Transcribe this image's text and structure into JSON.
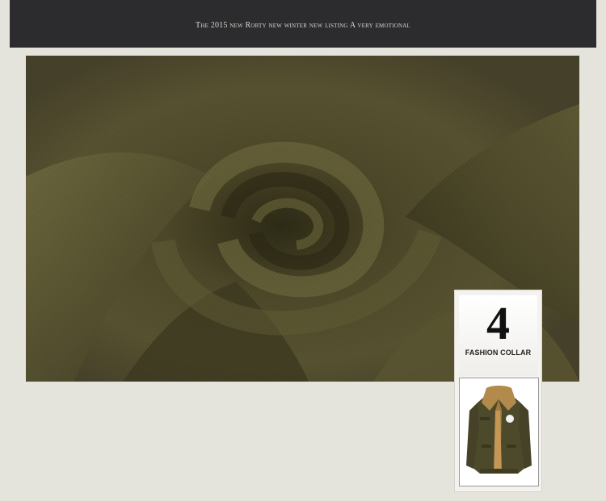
{
  "header": {
    "caption": "The 2015 new Rorty new winter new listing  A very emotional"
  },
  "hero": {
    "image_icon": "fabric-swirl-photo",
    "colors": {
      "fabric": "#4f4b2b",
      "fabric_light": "#6a6539",
      "fabric_dark": "#2b2815"
    }
  },
  "feature_badge": {
    "number": "4",
    "label": "FASHION COLLAR",
    "image_icon": "jacket-photo"
  }
}
